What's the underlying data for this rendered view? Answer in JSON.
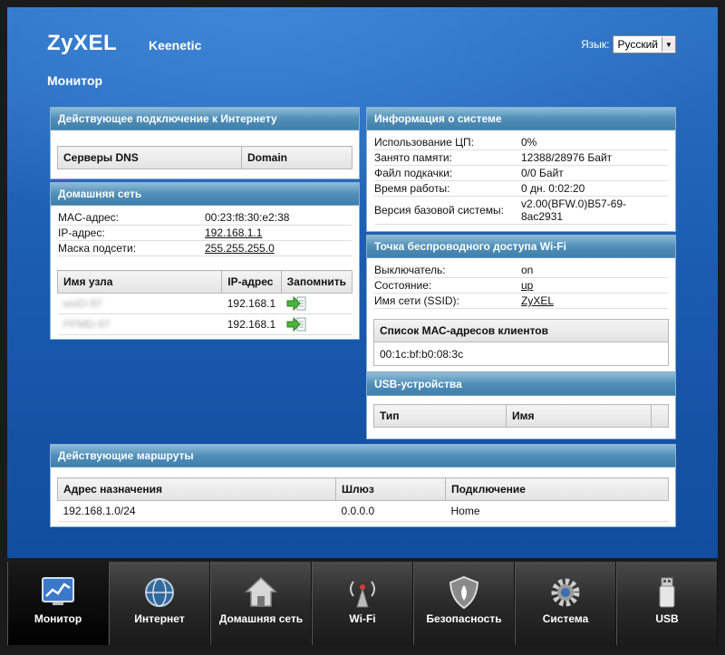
{
  "header": {
    "brand": "ZyXEL",
    "model": "Keenetic",
    "language_label": "Язык:",
    "language_value": "Русский",
    "page_title": "Монитор"
  },
  "internet": {
    "title": "Действующее подключение к Интернету",
    "dns_label": "Серверы DNS",
    "domain_label": "Domain"
  },
  "home": {
    "title": "Домашняя сеть",
    "rows": [
      {
        "k": "MAC-адрес:",
        "v": "00:23:f8:30:e2:38"
      },
      {
        "k": "IP-адрес:",
        "v": "192.168.1.1"
      },
      {
        "k": "Маска подсети:",
        "v": "255.255.255.0"
      }
    ],
    "hosts_headers": [
      "Имя узла",
      "IP-адрес",
      "Запомнить"
    ],
    "hosts": [
      {
        "name": "wsiD-97",
        "ip": "192.168.1"
      },
      {
        "name": "PPMD-97",
        "ip": "192.168.1"
      }
    ]
  },
  "system": {
    "title": "Информация о системе",
    "rows": [
      {
        "k": "Использование ЦП:",
        "v": "0%"
      },
      {
        "k": "Занято памяти:",
        "v": "12388/28976 Байт"
      },
      {
        "k": "Файл подкачки:",
        "v": "0/0 Байт"
      },
      {
        "k": "Время работы:",
        "v": "0 дн. 0:02:20"
      },
      {
        "k": "Версия базовой системы:",
        "v1": "v2.00(BFW.0)B57-69-",
        "v2": "8ac2931"
      }
    ]
  },
  "wifi": {
    "title": "Точка беспроводного доступа Wi-Fi",
    "rows": [
      {
        "k": "Выключатель:",
        "v": "on"
      },
      {
        "k": "Состояние:",
        "v": "up"
      },
      {
        "k": "Имя сети (SSID):",
        "v": "ZyXEL"
      }
    ],
    "clients_title": "Список МАС-адресов клиентов",
    "clients": [
      "00:1c:bf:b0:08:3c"
    ]
  },
  "usb": {
    "title": "USB-устройства",
    "headers": [
      "Тип",
      "Имя"
    ]
  },
  "routes": {
    "title": "Действующие маршруты",
    "headers": [
      "Адрес назначения",
      "Шлюз",
      "Подключение"
    ],
    "rows": [
      [
        "192.168.1.0/24",
        "0.0.0.0",
        "Home"
      ]
    ]
  },
  "nav": [
    {
      "label": "Монитор",
      "icon": "monitor-chart-icon",
      "active": true
    },
    {
      "label": "Интернет",
      "icon": "globe-icon"
    },
    {
      "label": "Домашняя сеть",
      "icon": "house-icon"
    },
    {
      "label": "Wi-Fi",
      "icon": "wifi-antenna-icon"
    },
    {
      "label": "Безопасность",
      "icon": "shield-icon"
    },
    {
      "label": "Система",
      "icon": "gear-icon"
    },
    {
      "label": "USB",
      "icon": "usb-stick-icon"
    }
  ],
  "colors": {
    "background": "#1d5fb3",
    "panel_header": "#4f8fb8",
    "nav": "#2a2a2a",
    "link": "#1a4fa0"
  }
}
